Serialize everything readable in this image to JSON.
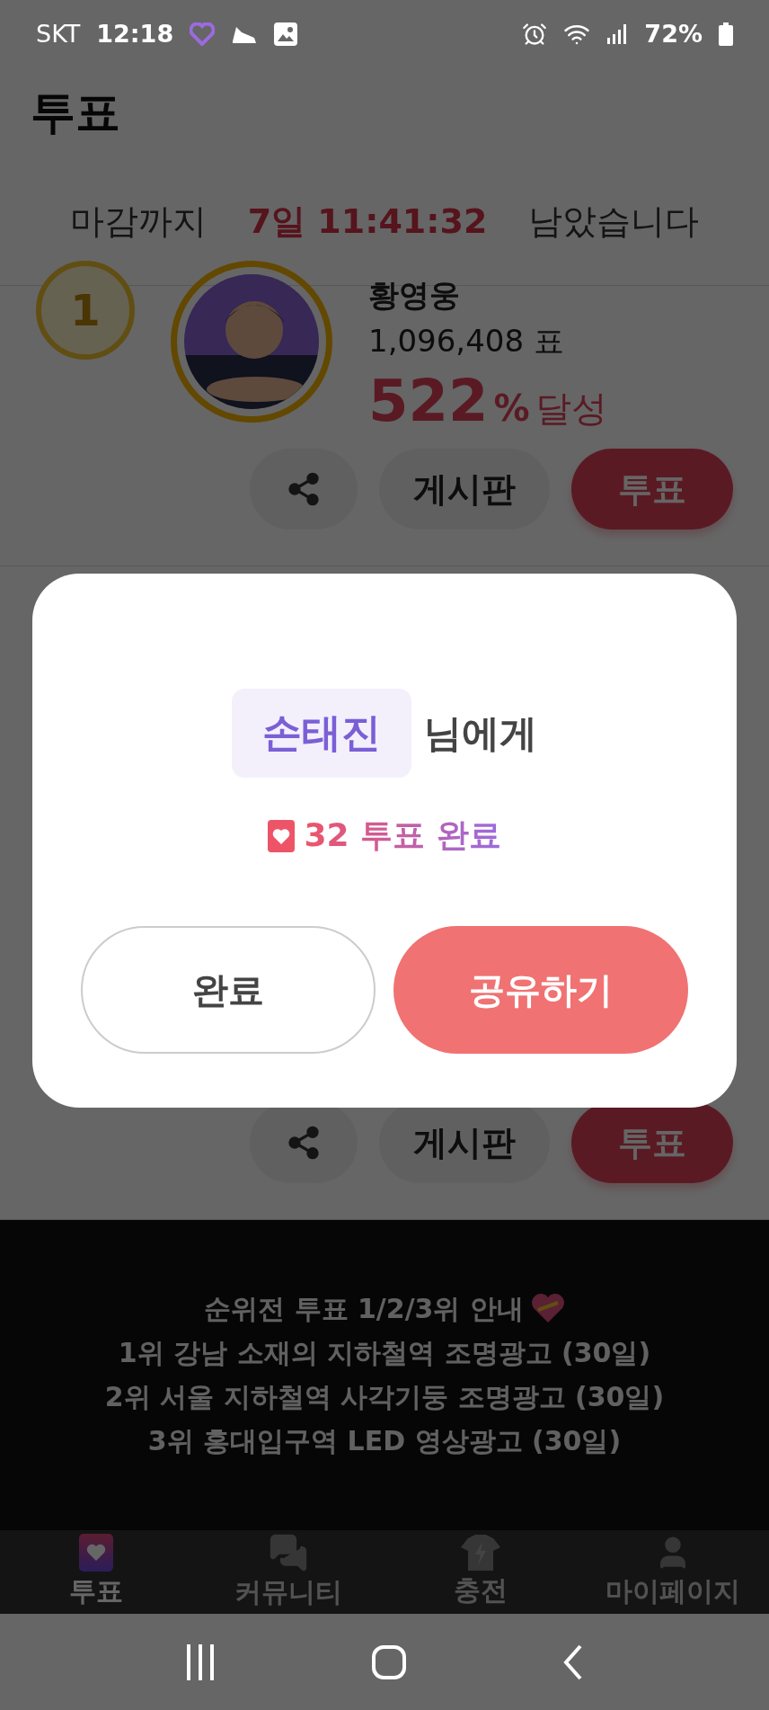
{
  "status_bar": {
    "carrier": "SKT",
    "time": "12:18",
    "battery": "72%"
  },
  "header": {
    "title": "투표"
  },
  "countdown": {
    "prefix": "마감까지",
    "time": "7일 11:41:32",
    "suffix": "남았습니다"
  },
  "cards": [
    {
      "kind": "full",
      "rank": "1",
      "name": "황영웅",
      "votes": "1,096,408 표",
      "percent": "522",
      "percent_sign": "%",
      "achieved": "달성",
      "board_label": "게시판",
      "vote_label": "투표"
    },
    {
      "kind": "buttons_only",
      "board_label": "게시판",
      "vote_label": "투표"
    }
  ],
  "banner": {
    "lines": [
      "순위전 투표 1/2/3위 안내",
      "1위 강남 소재의 지하철역 조명광고 (30일)",
      "2위 서울 지하철역 사각기둥 조명광고 (30일)",
      "3위 홍대입구역 LED 영상광고 (30일)"
    ]
  },
  "bottom_nav": [
    {
      "label": "투표",
      "selected": true
    },
    {
      "label": "커뮤니티",
      "selected": false
    },
    {
      "label": "충전",
      "selected": false
    },
    {
      "label": "마이페이지",
      "selected": false
    }
  ],
  "dialog": {
    "recipient": "손태진",
    "recipient_suffix": "님에게",
    "result": "32 투표 완료",
    "buttons": [
      {
        "label": "완료",
        "kind": "secondary"
      },
      {
        "label": "공유하기",
        "kind": "primary"
      }
    ]
  }
}
